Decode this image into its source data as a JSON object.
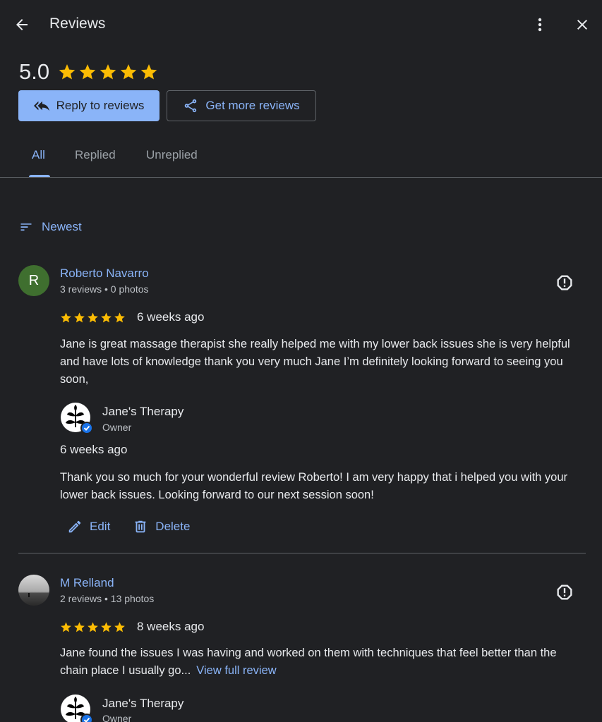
{
  "header": {
    "title": "Reviews",
    "back_icon": "arrow-back-icon",
    "more_icon": "more-vert-icon",
    "close_icon": "close-icon"
  },
  "summary": {
    "rating": "5.0",
    "stars": 5,
    "reply_button": "Reply to reviews",
    "get_more_button": "Get more reviews"
  },
  "tabs": [
    {
      "label": "All",
      "active": true
    },
    {
      "label": "Replied",
      "active": false
    },
    {
      "label": "Unreplied",
      "active": false
    }
  ],
  "sort": {
    "label": "Newest"
  },
  "reviews": [
    {
      "avatar_letter": "R",
      "name": "Roberto Navarro",
      "meta": "3 reviews • 0 photos",
      "rating": 5,
      "time": "6 weeks ago",
      "text": "Jane is great massage therapist she really helped me with my lower back issues she is very helpful and have lots of knowledge thank you very much Jane I’m definitely looking forward to seeing you soon,",
      "reply": {
        "owner_name": "Jane's Therapy",
        "owner_role": "Owner",
        "time": "6 weeks ago",
        "text": "Thank you so much for your wonderful review Roberto! I am very happy that i helped you with your lower back issues. Looking forward to our next session soon!",
        "edit_label": "Edit",
        "delete_label": "Delete"
      }
    },
    {
      "name": "M Relland",
      "meta": "2 reviews • 13 photos",
      "rating": 5,
      "time": "8 weeks ago",
      "text": "Jane found the issues I was having and worked on them with techniques that feel better than the chain place I usually go...",
      "view_full": "View full review",
      "reply": {
        "owner_name": "Jane's Therapy",
        "owner_role": "Owner"
      }
    }
  ],
  "colors": {
    "background": "#202124",
    "accent": "#8ab4f8",
    "star": "#fbbc04",
    "divider": "#5f6368",
    "avatar_green": "#3f6f2f"
  }
}
